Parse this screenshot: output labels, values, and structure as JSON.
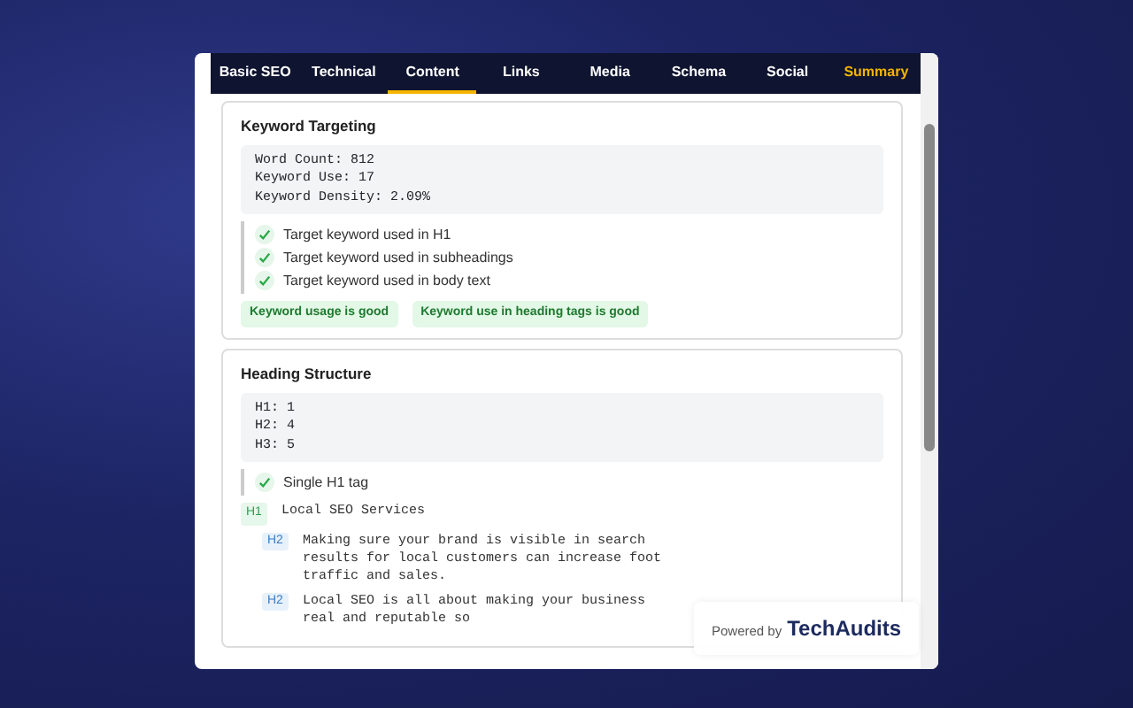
{
  "tabs": [
    {
      "label": "Basic SEO",
      "selected": false,
      "kind": "normal"
    },
    {
      "label": "Technical",
      "selected": false,
      "kind": "normal"
    },
    {
      "label": "Content",
      "selected": true,
      "kind": "normal"
    },
    {
      "label": "Links",
      "selected": false,
      "kind": "normal"
    },
    {
      "label": "Media",
      "selected": false,
      "kind": "normal"
    },
    {
      "label": "Schema",
      "selected": false,
      "kind": "normal"
    },
    {
      "label": "Social",
      "selected": false,
      "kind": "normal"
    },
    {
      "label": "Summary",
      "selected": false,
      "kind": "highlight"
    }
  ],
  "sections": [
    {
      "title": "Keyword Targeting",
      "stats": [
        "Word Count: 812",
        "Keyword Use: 17",
        "Keyword Density: 2.09%"
      ],
      "checks": [
        {
          "label": "Target keyword used in H1",
          "passed": true
        },
        {
          "label": "Target keyword used in subheadings",
          "passed": true
        },
        {
          "label": "Target keyword used in body text",
          "passed": true
        }
      ],
      "badges": [
        "Keyword usage is good",
        "Keyword use in heading tags is good"
      ]
    },
    {
      "title": "Heading Structure",
      "stats": [
        "H1: 1",
        "H2: 4",
        "H3: 5"
      ],
      "checks": [
        {
          "label": "Single H1 tag",
          "passed": true
        }
      ],
      "headings": [
        {
          "tag": "H1",
          "text": "Local SEO Services",
          "children": [
            {
              "tag": "H2",
              "text": "Making sure your brand is visible in search results for local customers can increase foot traffic and sales."
            },
            {
              "tag": "H2",
              "text": "Local SEO is all about making your business real and reputable so"
            }
          ]
        }
      ]
    }
  ],
  "powered_by": {
    "label": "Powered by",
    "brand": "TechAudits"
  }
}
